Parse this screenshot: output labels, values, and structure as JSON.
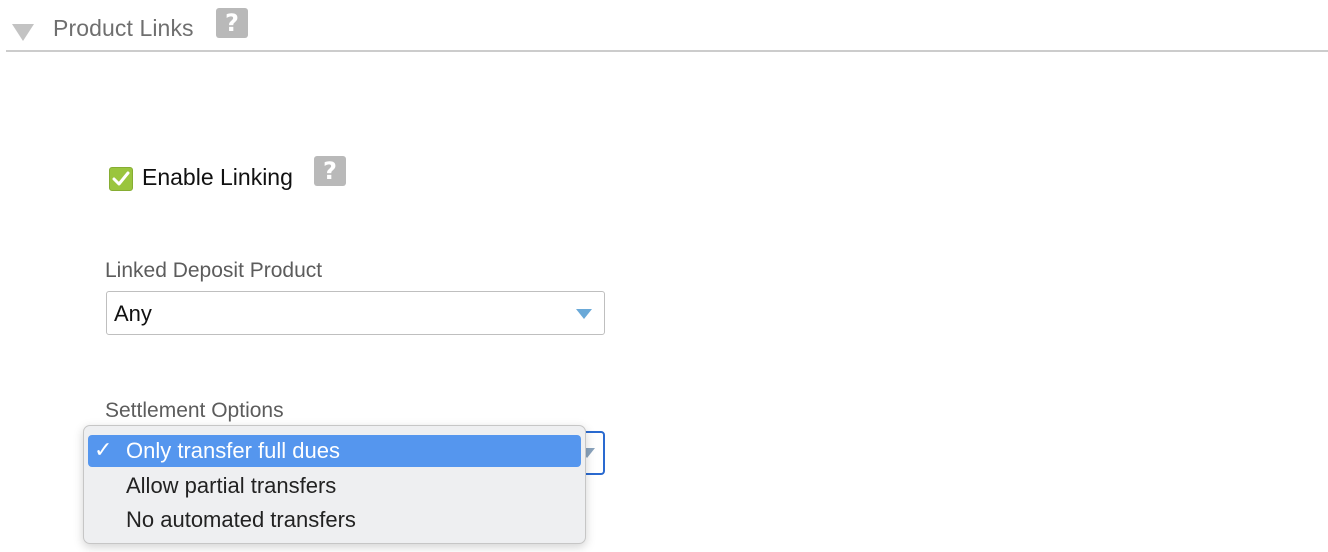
{
  "section": {
    "title": "Product Links",
    "help_glyph": "?",
    "collapse_icon": "triangle-down-icon"
  },
  "enable_linking": {
    "label": "Enable Linking",
    "checked": true,
    "help_glyph": "?"
  },
  "linked_deposit": {
    "label": "Linked Deposit Product",
    "value": "Any"
  },
  "settlement": {
    "label": "Settlement Options",
    "options": [
      {
        "label": "Only transfer full dues",
        "selected": true,
        "check": "✓"
      },
      {
        "label": "Allow partial transfers",
        "selected": false,
        "check": ""
      },
      {
        "label": "No automated transfers",
        "selected": false,
        "check": ""
      }
    ]
  },
  "colors": {
    "checkbox_green": "#9ac53e",
    "select_focus_blue": "#2a6ad0",
    "option_highlight": "#5596ee",
    "help_icon_gray": "#b9b9b9"
  }
}
